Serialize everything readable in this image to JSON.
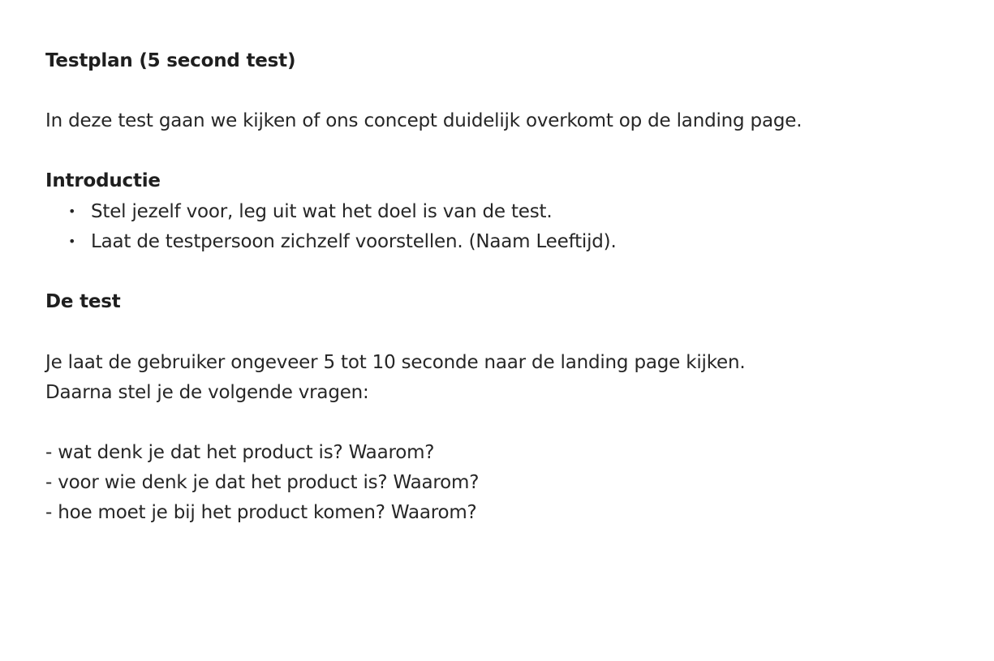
{
  "document": {
    "title": "Testplan (5 second test)",
    "intro_paragraph": "In deze test gaan we kijken of ons concept duidelijk overkomt op de landing page.",
    "sections": {
      "introductie": {
        "heading": "Introductie",
        "bullets": [
          "Stel jezelf voor, leg uit wat het doel is van de test.",
          "Laat de testpersoon zichzelf voorstellen. (Naam Leeftijd)."
        ],
        "bullet_glyph": "•"
      },
      "de_test": {
        "heading": "De test",
        "paragraph_lines": [
          "Je laat de gebruiker ongeveer 5 tot 10 seconde naar de landing page kijken.",
          "Daarna stel je de volgende vragen:"
        ],
        "questions": [
          "- wat denk je dat het product is? Waarom?",
          "- voor wie denk je dat het product is? Waarom?",
          "- hoe moet je bij het product komen? Waarom?"
        ]
      }
    }
  }
}
